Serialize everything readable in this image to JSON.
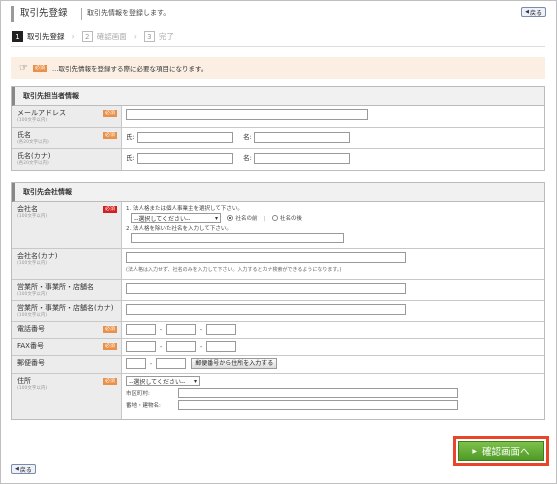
{
  "header": {
    "title": "取引先登録",
    "subtitle": "取引先情報を登録します。",
    "back_label": "戻る"
  },
  "steps": [
    {
      "num": "1",
      "label": "取引先登録",
      "active": true
    },
    {
      "num": "2",
      "label": "確認画面",
      "active": false
    },
    {
      "num": "3",
      "label": "完了",
      "active": false
    }
  ],
  "notice": {
    "badge": "必須",
    "text": "…取引先情報を登録する際に必要な項目になります。"
  },
  "contact_section": {
    "title": "取引先担当者情報",
    "email": {
      "label": "メールアドレス",
      "sub": "(100文字以内)",
      "badge": "必須",
      "value": ""
    },
    "name": {
      "label": "氏名",
      "sub": "(各20文字以内)",
      "badge": "必須",
      "last_label": "氏:",
      "first_label": "名:"
    },
    "name_kana": {
      "label": "氏名(カナ)",
      "sub": "(各20文字以内)",
      "last_label": "氏:",
      "first_label": "名:"
    }
  },
  "company_section": {
    "title": "取引先会社情報",
    "company_name": {
      "label": "会社名",
      "sub": "(100文字以内)",
      "badge": "必須",
      "instruction1": "1. 法人格または個人事業主を選択して下さい。",
      "select_value": "--選択してください--",
      "radio_before": "社名の前",
      "radio_after": "社名の後",
      "instruction2": "2. 法人格を除いた社名を入力して下さい。"
    },
    "company_kana": {
      "label": "会社名(カナ)",
      "sub": "(100文字以内)",
      "hint": "(法人格は入力せず、社名のみを入力して下さい。入力するとカナ検索ができるようになります。)"
    },
    "office": {
      "label": "営業所・事業所・店舗名",
      "sub": "(100文字以内)"
    },
    "office_kana": {
      "label": "営業所・事業所・店舗名(カナ)",
      "sub": "(100文字以内)"
    },
    "phone": {
      "label": "電話番号",
      "badge": "必須"
    },
    "fax": {
      "label": "FAX番号",
      "badge": "必須"
    },
    "postal": {
      "label": "郵便番号",
      "button": "郵便番号から住所を入力する"
    },
    "address": {
      "label": "住所",
      "sub": "(100文字以内)",
      "badge": "必須",
      "prefecture_select": "--選択してください--",
      "city_label": "市区町村:",
      "street_label": "番地・建物名:"
    }
  },
  "confirm_button": "確認画面へ",
  "colors": {
    "accent_green": "#5aa92f",
    "highlight_red": "#e8452a",
    "required_badge": "#e8914a",
    "required_red": "#d02020"
  }
}
